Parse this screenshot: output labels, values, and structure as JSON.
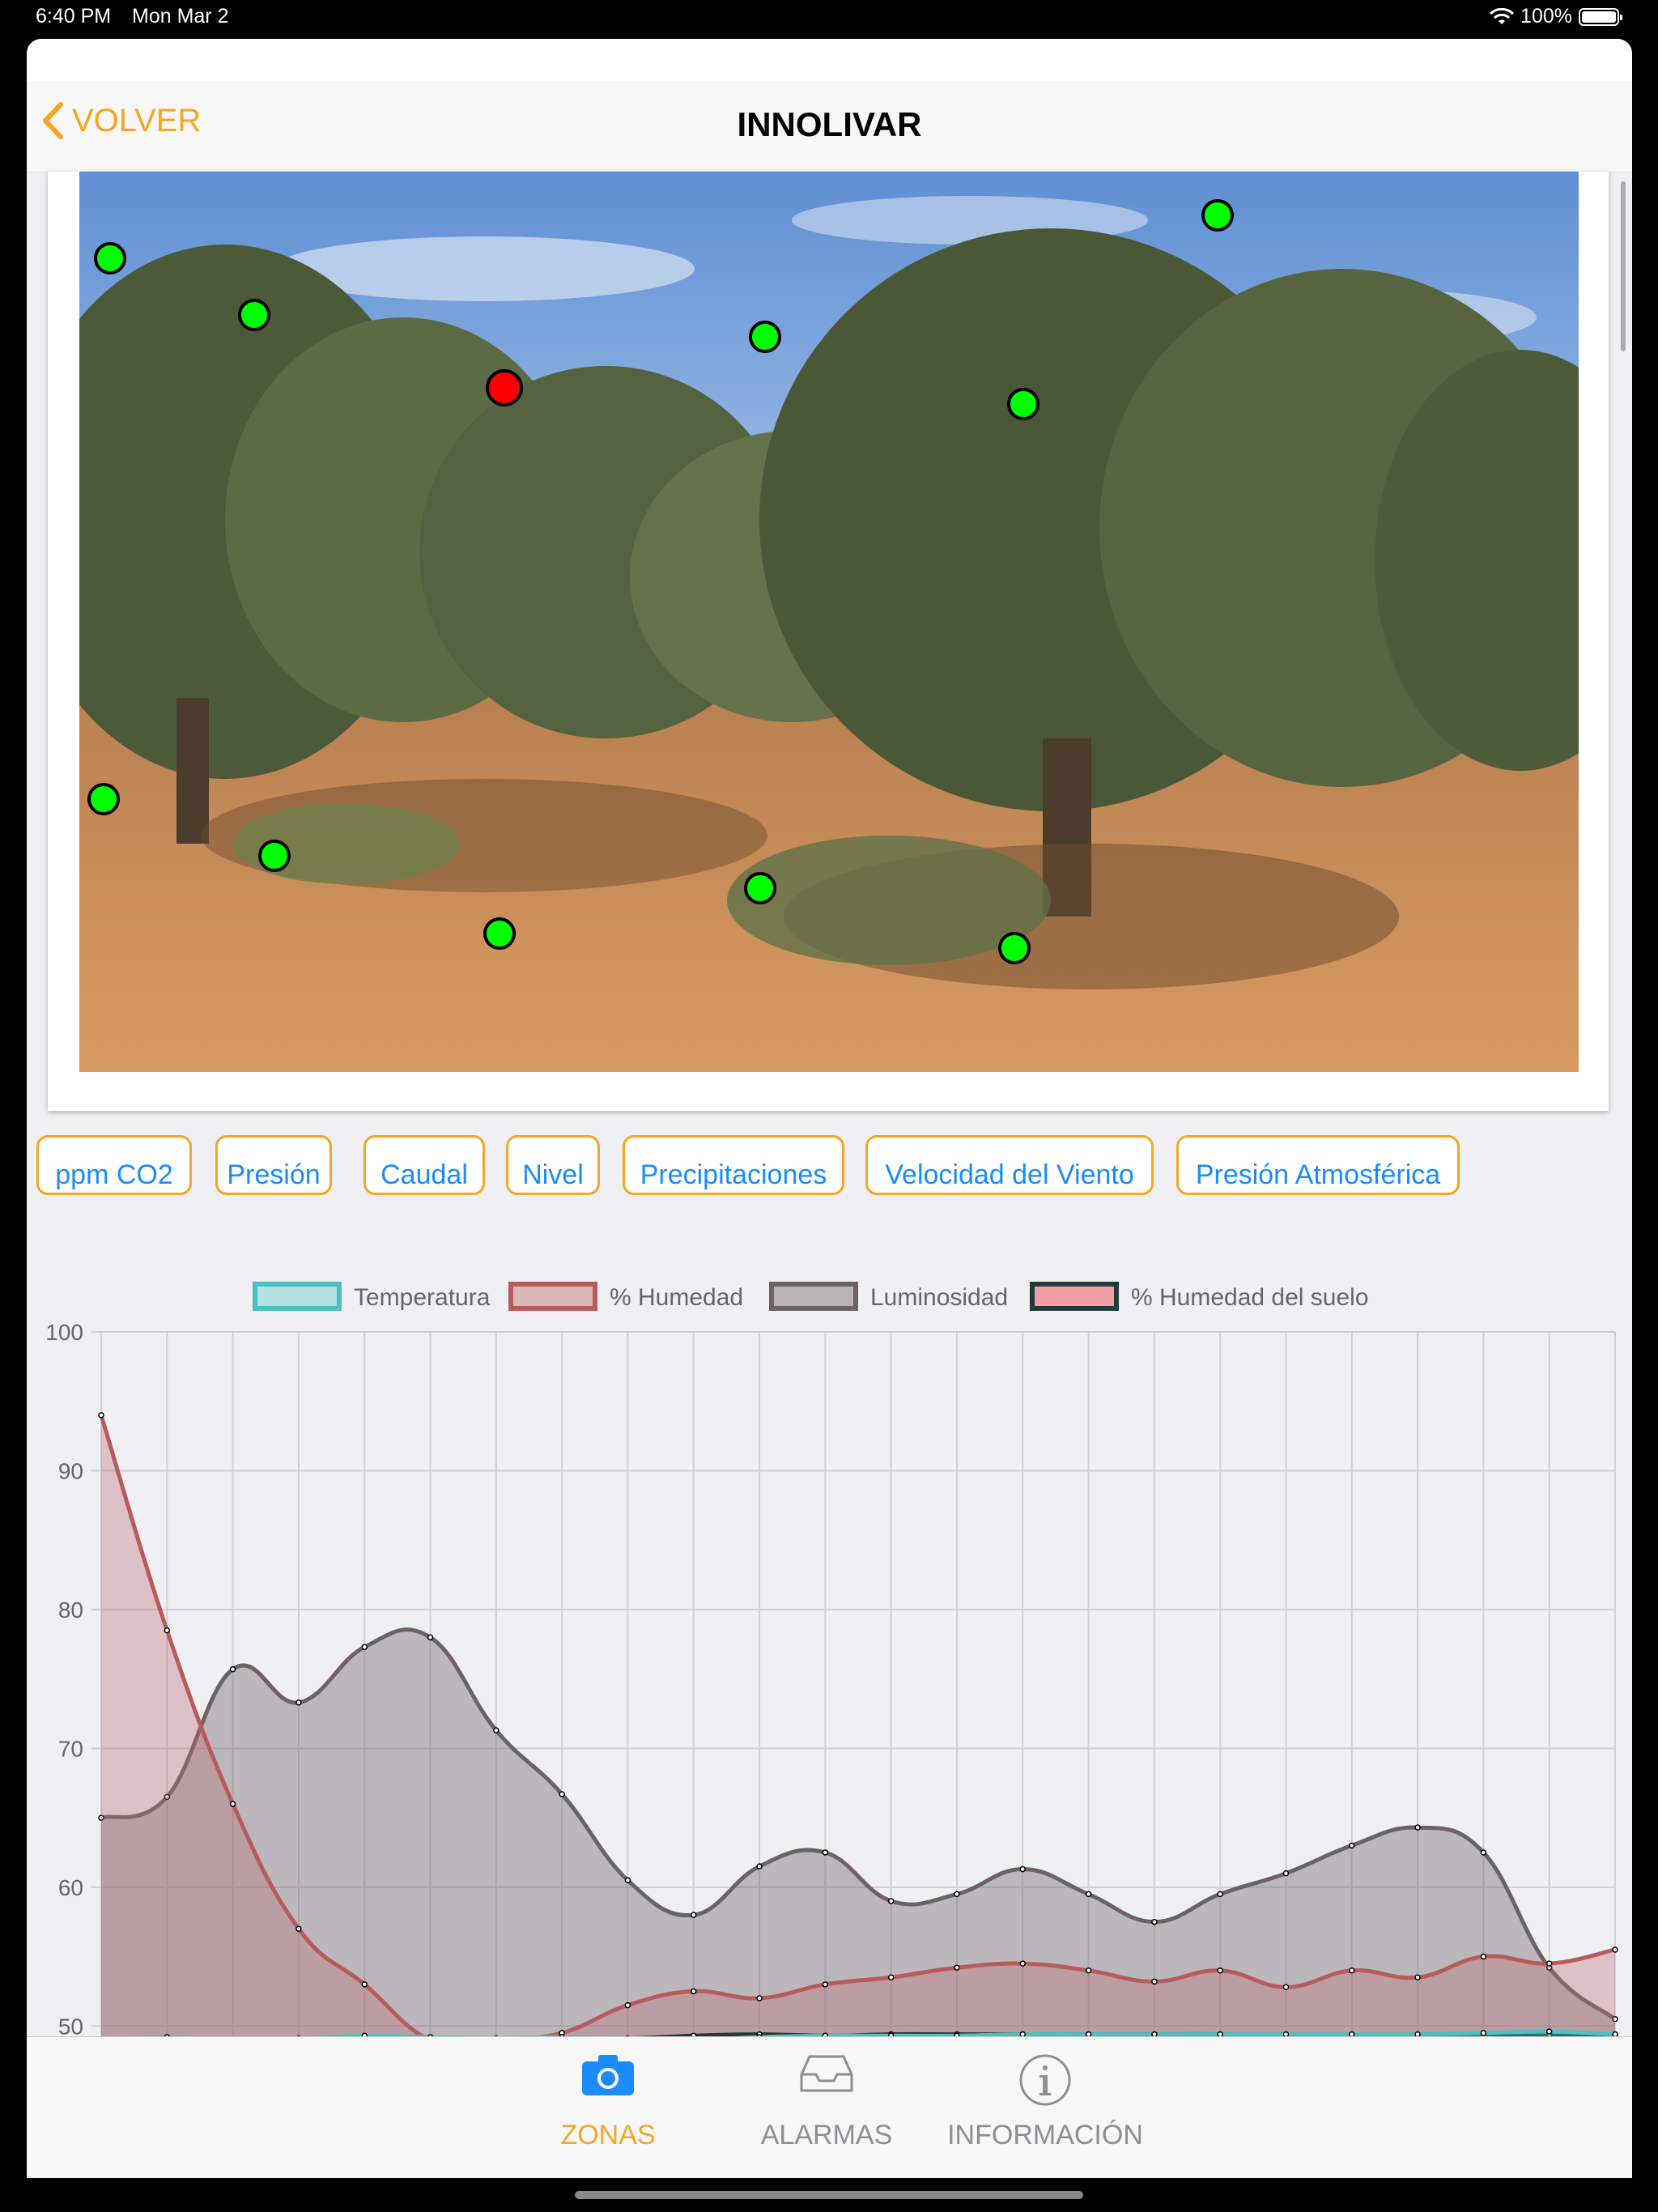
{
  "status": {
    "time": "6:40 PM",
    "date": "Mon Mar 2",
    "battery": "100%"
  },
  "nav": {
    "back_label": "VOLVER",
    "title": "INNOLIVAR"
  },
  "sensors": [
    {
      "state": "ok"
    },
    {
      "state": "ok"
    },
    {
      "state": "alert"
    },
    {
      "state": "ok"
    },
    {
      "state": "ok"
    },
    {
      "state": "ok"
    },
    {
      "state": "ok"
    },
    {
      "state": "ok"
    },
    {
      "state": "ok"
    },
    {
      "state": "ok"
    },
    {
      "state": "ok"
    }
  ],
  "filters": [
    "ppm CO2",
    "Presión",
    "Caudal",
    "Nivel",
    "Precipitaciones",
    "Velocidad del Viento",
    "Presión Atmosférica"
  ],
  "chart_data": {
    "type": "area",
    "x_count": 24,
    "ylim": [
      48.5,
      100
    ],
    "yticks": [
      50,
      60,
      70,
      80,
      90,
      100
    ],
    "legend_position": "top-center",
    "grid": true,
    "series": [
      {
        "name": "Temperatura",
        "color": "#4bc0c0",
        "fill": "rgba(75,192,192,0.4)",
        "values": [
          49.0,
          49.2,
          49.0,
          49.1,
          49.3,
          49.2,
          49.1,
          49.2,
          49.1,
          49.0,
          49.2,
          49.3,
          49.3,
          49.3,
          49.4,
          49.4,
          49.4,
          49.4,
          49.4,
          49.4,
          49.4,
          49.5,
          49.6,
          49.4
        ]
      },
      {
        "name": "% Humedad",
        "color": "#b85b5b",
        "fill": "rgba(190,110,115,0.35)",
        "values": [
          94.0,
          78.5,
          66.0,
          57.0,
          53.0,
          49.0,
          49.0,
          49.5,
          51.5,
          52.5,
          52.0,
          53.0,
          53.5,
          54.2,
          54.5,
          54.0,
          53.2,
          54.0,
          52.8,
          54.0,
          53.5,
          55.0,
          54.5,
          55.5
        ]
      },
      {
        "name": "Luminosidad",
        "color": "#6e6163",
        "fill": "rgba(110,100,105,0.4)",
        "values": [
          65.0,
          66.5,
          75.7,
          73.3,
          77.3,
          78.0,
          71.3,
          66.7,
          60.5,
          58.0,
          61.5,
          62.5,
          59.0,
          59.5,
          61.3,
          59.5,
          57.5,
          59.5,
          61.0,
          63.0,
          64.3,
          62.5,
          54.2,
          50.5
        ]
      },
      {
        "name": "% Humedad del suelo",
        "color": "#1f3a3a",
        "fill": "rgba(205,70,75,0.65)",
        "values": [
          48.8,
          49.0,
          48.9,
          49.0,
          49.1,
          49.0,
          49.0,
          49.1,
          49.1,
          49.3,
          49.4,
          49.3,
          49.4,
          49.4,
          49.4,
          49.4,
          49.4,
          49.4,
          49.3,
          49.3,
          49.3,
          49.3,
          49.4,
          49.2
        ]
      }
    ]
  },
  "tabs": [
    {
      "label": "ZONAS",
      "icon": "camera-icon",
      "active": true
    },
    {
      "label": "ALARMAS",
      "icon": "inbox-icon",
      "active": false
    },
    {
      "label": "INFORMACIÓN",
      "icon": "info-icon",
      "active": false
    }
  ]
}
